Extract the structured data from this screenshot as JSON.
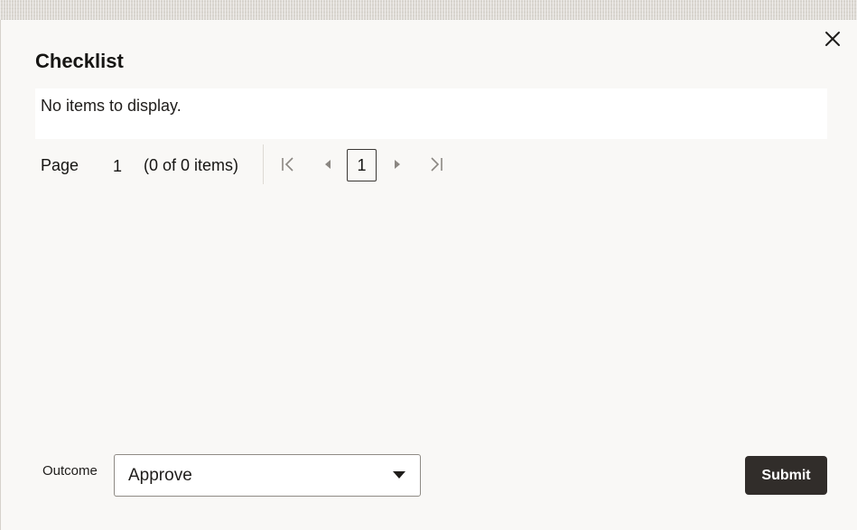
{
  "dialog": {
    "title": "Checklist",
    "close_icon": "close-icon"
  },
  "table": {
    "empty_message": "No items to display."
  },
  "pagination": {
    "page_label": "Page",
    "current_page": "1",
    "items_summary": "(0 of 0 items)",
    "page_button": "1",
    "icons": [
      "first-page-icon",
      "previous-page-icon",
      "next-page-icon",
      "last-page-icon"
    ]
  },
  "footer": {
    "outcome_label": "Outcome",
    "outcome_value": "Approve",
    "caret_icon": "caret-down-icon",
    "submit_label": "Submit"
  },
  "colors": {
    "dialog_background": "#f9f8f6",
    "submit_background": "#312d2a",
    "text": "#161513",
    "disabled_icon": "#8b8782"
  }
}
